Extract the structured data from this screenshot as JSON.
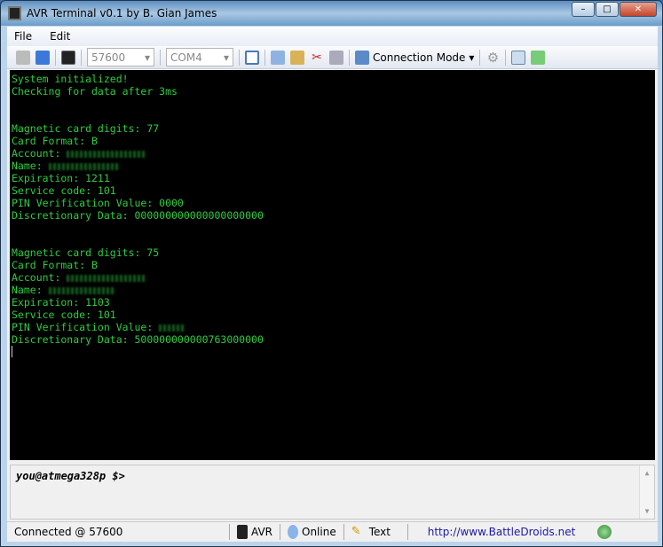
{
  "window": {
    "title": "AVR Terminal v0.1 by B. Gian James",
    "minimize": "–",
    "maximize": "□",
    "close": "✕"
  },
  "menu": [
    "File",
    "Edit"
  ],
  "toolbar": {
    "baud": "57600",
    "port": "COM4",
    "connection_mode": "Connection Mode"
  },
  "terminal": {
    "lines": [
      "System initialized!",
      "Checking for data after 3ms",
      "",
      "",
      "Magnetic card digits: 77",
      "Card Format: B"
    ],
    "card1": {
      "account": "Account: ",
      "name": "Name: ",
      "expiration": "Expiration: 1211",
      "service": "Service code: 101",
      "pin": "PIN Verification Value: 0000",
      "disc": "Discretionary Data: 000000000000000000000"
    },
    "card2": {
      "digits": "Magnetic card digits: 75",
      "format": "Card Format: B",
      "account": "Account: ",
      "name": "Name: ",
      "expiration": "Expiration: 1103",
      "service": "Service code: 101",
      "pin": "PIN Verification Value: ",
      "disc": "Discretionary Data: 500000000000763000000"
    }
  },
  "prompt": "you@atmega328p $>",
  "status": {
    "connected": "Connected @ 57600",
    "device": "AVR",
    "online": "Online",
    "mode": "Text",
    "link": "http://www.BattleDroids.net"
  }
}
